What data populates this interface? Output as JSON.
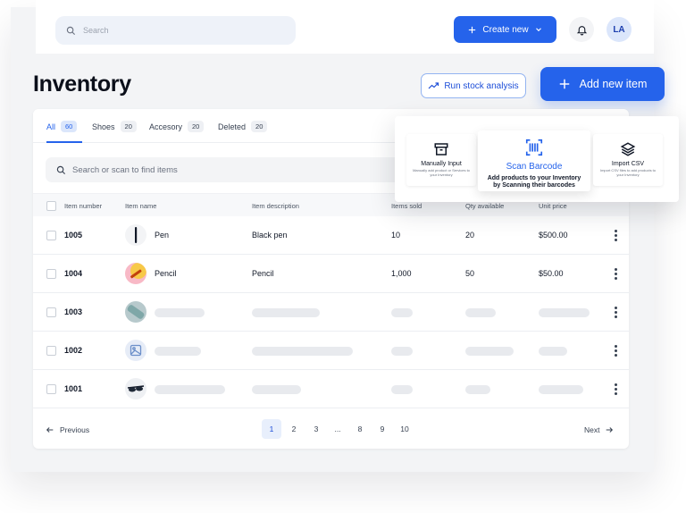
{
  "header": {
    "search_placeholder": "Search",
    "create_label": "Create new",
    "avatar_initials": "LA"
  },
  "page": {
    "title": "Inventory",
    "run_analysis_label": "Run stock analysis",
    "add_item_label": "Add new item"
  },
  "tabs": [
    {
      "label": "All",
      "count": "60"
    },
    {
      "label": "Shoes",
      "count": "20"
    },
    {
      "label": "Accesory",
      "count": "20"
    },
    {
      "label": "Deleted",
      "count": "20"
    }
  ],
  "inventory_search": {
    "placeholder": "Search or scan to find items"
  },
  "table": {
    "columns": [
      "Item number",
      "Item name",
      "Item description",
      "Items sold",
      "Qty available",
      "Unit price"
    ],
    "rows": [
      {
        "number": "1005",
        "name": "Pen",
        "description": "Black pen",
        "sold": "10",
        "qty": "20",
        "price": "$500.00"
      },
      {
        "number": "1004",
        "name": "Pencil",
        "description": "Pencil",
        "sold": "1,000",
        "qty": "50",
        "price": "$50.00"
      },
      {
        "number": "1003",
        "name": "",
        "description": "",
        "sold": "",
        "qty": "",
        "price": ""
      },
      {
        "number": "1002",
        "name": "",
        "description": "",
        "sold": "",
        "qty": "",
        "price": ""
      },
      {
        "number": "1001",
        "name": "",
        "description": "",
        "sold": "",
        "qty": "",
        "price": ""
      }
    ]
  },
  "pagination": {
    "prev_label": "Previous",
    "next_label": "Next",
    "pages": [
      "1",
      "2",
      "3",
      "...",
      "8",
      "9",
      "10"
    ]
  },
  "add_popover": {
    "manual": {
      "title": "Manually Input",
      "subtitle": "Manually add product or Services to your Inventory"
    },
    "scan": {
      "title": "Scan Barcode",
      "subtitle": "Add products to your Inventory by Scanning their barcodes"
    },
    "csv": {
      "title": "Import CSV",
      "subtitle": "Import CSV files to add products to your Inventory"
    }
  },
  "colors": {
    "accent": "#2563eb",
    "accent_soft": "#dbe6fb",
    "skeleton": "#e8eaee"
  }
}
